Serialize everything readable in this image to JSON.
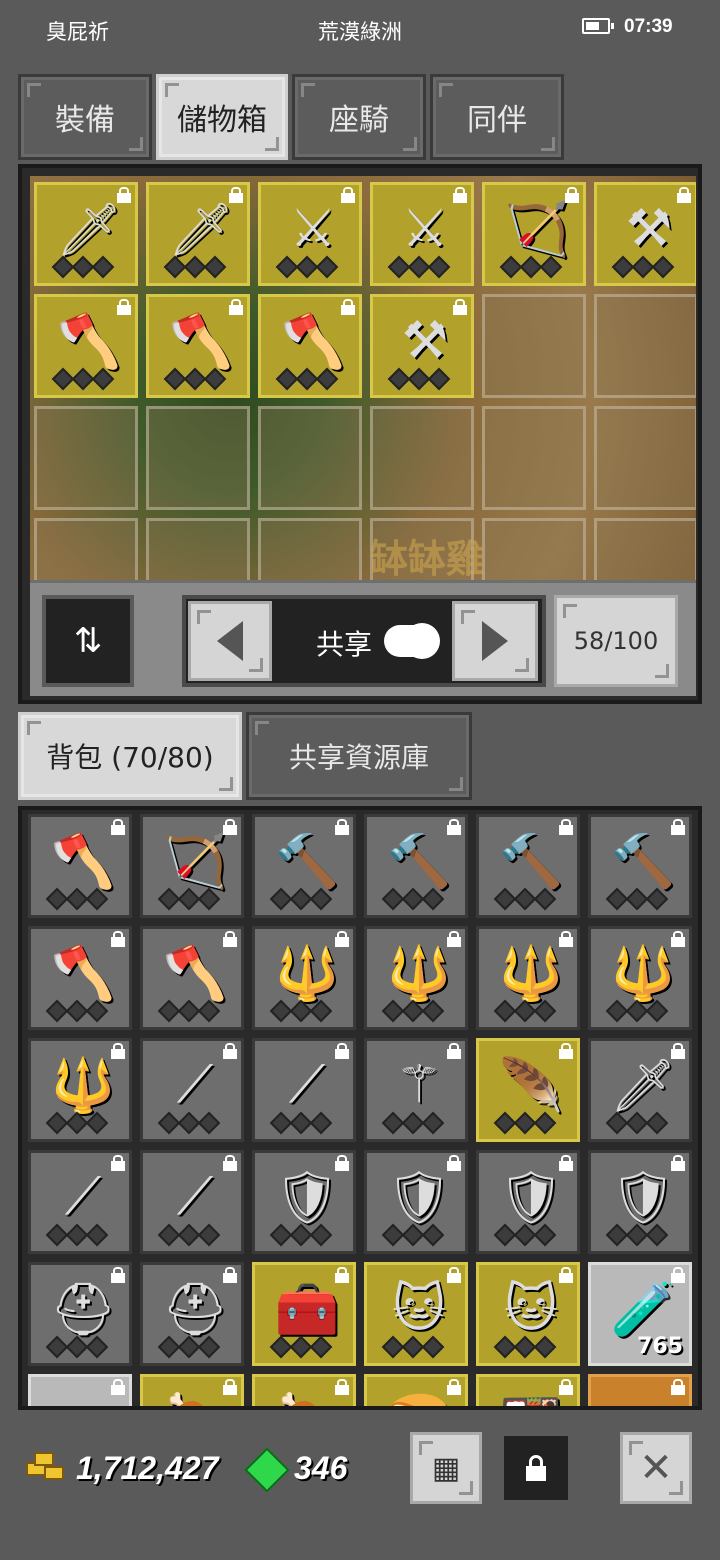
{
  "status": {
    "left_text": "臭屁祈",
    "center_text": "荒漠綠洲",
    "time": "07:39"
  },
  "tabs": [
    {
      "label": "裝備",
      "active": false
    },
    {
      "label": "儲物箱",
      "active": true
    },
    {
      "label": "座騎",
      "active": false
    },
    {
      "label": "同伴",
      "active": false
    }
  ],
  "storage": {
    "watermark": "缽缽雞",
    "slots": [
      {
        "item": "dagger-icon",
        "style": "gold",
        "glyph": "🗡"
      },
      {
        "item": "dagger-icon",
        "style": "gold",
        "glyph": "🗡"
      },
      {
        "item": "crossbow-icon",
        "style": "gold",
        "glyph": "⚔"
      },
      {
        "item": "crossbow-icon",
        "style": "gold",
        "glyph": "⚔"
      },
      {
        "item": "bow-icon",
        "style": "gold",
        "glyph": "🏹"
      },
      {
        "item": "scythe-icon",
        "style": "gold",
        "glyph": "⚒"
      },
      {
        "item": "axe-icon",
        "style": "gold",
        "glyph": "🪓"
      },
      {
        "item": "axe-icon",
        "style": "gold",
        "glyph": "🪓"
      },
      {
        "item": "axe-icon",
        "style": "gold",
        "glyph": "🪓"
      },
      {
        "item": "scythe-icon",
        "style": "gold",
        "glyph": "⚒"
      },
      {
        "item": "",
        "style": "empty",
        "glyph": ""
      },
      {
        "item": "",
        "style": "empty",
        "glyph": ""
      },
      {
        "item": "",
        "style": "empty",
        "glyph": ""
      },
      {
        "item": "",
        "style": "empty",
        "glyph": ""
      },
      {
        "item": "",
        "style": "empty",
        "glyph": ""
      },
      {
        "item": "",
        "style": "empty",
        "glyph": ""
      },
      {
        "item": "",
        "style": "empty",
        "glyph": ""
      },
      {
        "item": "",
        "style": "empty",
        "glyph": ""
      },
      {
        "item": "",
        "style": "empty",
        "glyph": ""
      },
      {
        "item": "",
        "style": "empty",
        "glyph": ""
      },
      {
        "item": "",
        "style": "empty",
        "glyph": ""
      },
      {
        "item": "",
        "style": "empty",
        "glyph": ""
      },
      {
        "item": "",
        "style": "empty",
        "glyph": ""
      },
      {
        "item": "",
        "style": "empty",
        "glyph": ""
      }
    ],
    "share_label": "共享",
    "capacity": "58/100"
  },
  "bag_tabs": [
    {
      "label": "背包 (70/80)",
      "active": true
    },
    {
      "label": "共享資源庫",
      "active": false
    }
  ],
  "bag": {
    "slots": [
      {
        "item": "axe-icon",
        "style": "gray",
        "glyph": "🪓"
      },
      {
        "item": "bow-icon",
        "style": "gray",
        "glyph": "🏹"
      },
      {
        "item": "hammer-icon",
        "style": "gray",
        "glyph": "🔨"
      },
      {
        "item": "hammer-icon",
        "style": "gray",
        "glyph": "🔨"
      },
      {
        "item": "hammer-icon",
        "style": "gray",
        "glyph": "🔨"
      },
      {
        "item": "hammer-icon",
        "style": "gray",
        "glyph": "🔨"
      },
      {
        "item": "axe-icon",
        "style": "gray",
        "glyph": "🪓"
      },
      {
        "item": "axe-icon",
        "style": "gray",
        "glyph": "🪓"
      },
      {
        "item": "staff-icon",
        "style": "gray",
        "glyph": "🔱"
      },
      {
        "item": "staff-icon",
        "style": "gray",
        "glyph": "🔱"
      },
      {
        "item": "staff-icon",
        "style": "gray",
        "glyph": "🔱"
      },
      {
        "item": "staff-icon",
        "style": "gray",
        "glyph": "🔱"
      },
      {
        "item": "staff-icon",
        "style": "gray",
        "glyph": "🔱"
      },
      {
        "item": "spear-icon",
        "style": "gray",
        "glyph": "⟋"
      },
      {
        "item": "spear-icon",
        "style": "gray",
        "glyph": "⟋"
      },
      {
        "item": "staff-icon",
        "style": "gray",
        "glyph": "⚚"
      },
      {
        "item": "feather-icon",
        "style": "gold",
        "glyph": "🪶"
      },
      {
        "item": "sword-icon",
        "style": "gray",
        "glyph": "🗡"
      },
      {
        "item": "wand-icon",
        "style": "gray",
        "glyph": "⟋"
      },
      {
        "item": "wand-icon",
        "style": "gray",
        "glyph": "⟋"
      },
      {
        "item": "armor-icon",
        "style": "gray",
        "glyph": "🛡"
      },
      {
        "item": "armor-icon",
        "style": "gray",
        "glyph": "🛡"
      },
      {
        "item": "shield-icon",
        "style": "gray",
        "glyph": "🛡"
      },
      {
        "item": "shield-icon",
        "style": "gray",
        "glyph": "🛡"
      },
      {
        "item": "helmet-icon",
        "style": "gray",
        "glyph": "⛑"
      },
      {
        "item": "helmet-icon",
        "style": "gray",
        "glyph": "⛑"
      },
      {
        "item": "chest-icon",
        "style": "gold",
        "glyph": "🧰"
      },
      {
        "item": "cat-pet-icon",
        "style": "gold",
        "glyph": "🐱"
      },
      {
        "item": "cat-pet-icon",
        "style": "gold",
        "glyph": "🐱"
      },
      {
        "item": "potion-icon",
        "style": "light",
        "glyph": "🧪",
        "qty": "765"
      },
      {
        "item": "scroll-icon",
        "style": "light",
        "glyph": ""
      },
      {
        "item": "meat-icon",
        "style": "gold",
        "glyph": "🍖"
      },
      {
        "item": "meat-icon",
        "style": "gold",
        "glyph": "🍖"
      },
      {
        "item": "food-icon",
        "style": "gold",
        "glyph": "🍞"
      },
      {
        "item": "food-icon",
        "style": "gold",
        "glyph": "🍱"
      },
      {
        "item": "bag-icon",
        "style": "orange",
        "glyph": ""
      }
    ]
  },
  "currency": {
    "gold": "1,712,427",
    "gems": "346"
  }
}
